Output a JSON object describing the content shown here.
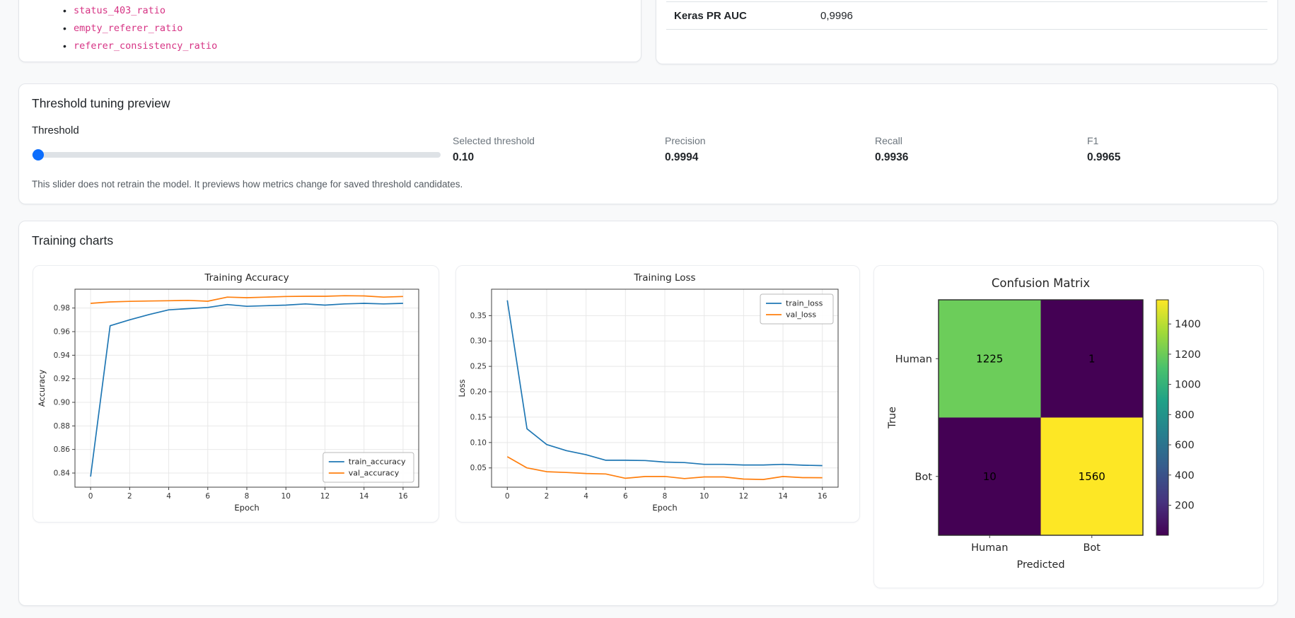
{
  "features": {
    "items": [
      "status_403_ratio",
      "empty_referer_ratio",
      "referer_consistency_ratio"
    ],
    "code_color": "#d63384"
  },
  "metric_table": {
    "rows": [
      {
        "label": "Keras PR AUC",
        "value": "0,9996"
      }
    ]
  },
  "threshold": {
    "title": "Threshold tuning preview",
    "slider_label": "Threshold",
    "slider": {
      "value": "0.10",
      "thumb_position_pct": 1.5,
      "accent_color": "#0d6efd"
    },
    "metrics": [
      {
        "label": "Selected threshold",
        "value": "0.10"
      },
      {
        "label": "Precision",
        "value": "0.9994"
      },
      {
        "label": "Recall",
        "value": "0.9936"
      },
      {
        "label": "F1",
        "value": "0.9965"
      }
    ],
    "note": "This slider does not retrain the model. It previews how metrics change for saved threshold candidates."
  },
  "training": {
    "title": "Training charts"
  },
  "chart_data": [
    {
      "type": "line",
      "title": "Training Accuracy",
      "xlabel": "Epoch",
      "ylabel": "Accuracy",
      "x": [
        0,
        1,
        2,
        3,
        4,
        5,
        6,
        7,
        8,
        9,
        10,
        11,
        12,
        13,
        14,
        15,
        16
      ],
      "series": [
        {
          "name": "train_accuracy",
          "color": "#1f77b4",
          "values": [
            0.837,
            0.965,
            0.97,
            0.9745,
            0.9785,
            0.9795,
            0.9805,
            0.983,
            0.9815,
            0.982,
            0.9825,
            0.9835,
            0.9825,
            0.9835,
            0.984,
            0.9835,
            0.984
          ]
        },
        {
          "name": "val_accuracy",
          "color": "#ff7f0e",
          "values": [
            0.984,
            0.9852,
            0.9857,
            0.986,
            0.9862,
            0.9865,
            0.9858,
            0.9893,
            0.9888,
            0.9893,
            0.9898,
            0.99,
            0.99,
            0.9905,
            0.9903,
            0.9893,
            0.9898
          ]
        }
      ],
      "xlim": [
        -0.8,
        16.8
      ],
      "ylim": [
        0.828,
        0.996
      ],
      "xticks": [
        0,
        2,
        4,
        6,
        8,
        10,
        12,
        14,
        16
      ],
      "yticks": [
        0.84,
        0.86,
        0.88,
        0.9,
        0.92,
        0.94,
        0.96,
        0.98
      ],
      "legend_position": "lower right",
      "grid": true
    },
    {
      "type": "line",
      "title": "Training Loss",
      "xlabel": "Epoch",
      "ylabel": "Loss",
      "x": [
        0,
        1,
        2,
        3,
        4,
        5,
        6,
        7,
        8,
        9,
        10,
        11,
        12,
        13,
        14,
        15,
        16
      ],
      "series": [
        {
          "name": "train_loss",
          "color": "#1f77b4",
          "values": [
            0.38,
            0.127,
            0.096,
            0.084,
            0.076,
            0.065,
            0.065,
            0.0645,
            0.0615,
            0.0605,
            0.057,
            0.057,
            0.0558,
            0.0557,
            0.057,
            0.0553,
            0.0545
          ]
        },
        {
          "name": "val_loss",
          "color": "#ff7f0e",
          "values": [
            0.072,
            0.05,
            0.0425,
            0.041,
            0.039,
            0.038,
            0.0295,
            0.033,
            0.0332,
            0.029,
            0.0322,
            0.0322,
            0.028,
            0.0272,
            0.033,
            0.0308,
            0.0307
          ]
        }
      ],
      "xlim": [
        -0.8,
        16.8
      ],
      "ylim": [
        0.012,
        0.402
      ],
      "xticks": [
        0,
        2,
        4,
        6,
        8,
        10,
        12,
        14,
        16
      ],
      "yticks": [
        0.05,
        0.1,
        0.15,
        0.2,
        0.25,
        0.3,
        0.35
      ],
      "legend_position": "upper right",
      "grid": true
    },
    {
      "type": "heatmap",
      "title": "Confusion Matrix",
      "xlabel": "Predicted",
      "ylabel": "True",
      "x_categories": [
        "Human",
        "Bot"
      ],
      "y_categories": [
        "Human",
        "Bot"
      ],
      "matrix": [
        [
          1225,
          1
        ],
        [
          10,
          1560
        ]
      ],
      "cell_colors": [
        [
          "#6ccd5a",
          "#440154"
        ],
        [
          "#440154",
          "#fde725"
        ]
      ],
      "colorbar": {
        "vmin": 1,
        "vmax": 1560,
        "ticks": [
          200,
          400,
          600,
          800,
          1000,
          1200,
          1400
        ]
      },
      "colormap": "viridis"
    }
  ]
}
